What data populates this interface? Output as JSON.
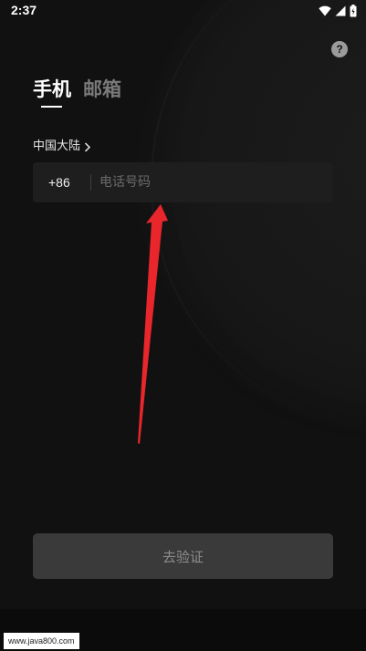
{
  "status_bar": {
    "time": "2:37",
    "icons": [
      "wifi-icon",
      "signal-icon",
      "battery-icon"
    ]
  },
  "help": {
    "label": "?",
    "icon": "question-mark-icon"
  },
  "tabs": [
    {
      "label": "手机",
      "active": true
    },
    {
      "label": "邮箱",
      "active": false
    }
  ],
  "region": {
    "label": "中国大陆",
    "icon": "chevron-right-icon"
  },
  "phone": {
    "country_code": "+86",
    "placeholder": "电话号码",
    "value": ""
  },
  "verify_button": {
    "label": "去验证"
  },
  "annotation": {
    "icon": "red-arrow-icon",
    "color": "#e8262b"
  },
  "watermark": {
    "text": "www.java800.com"
  },
  "colors": {
    "background": "#111111",
    "input_bg": "#1e1e1e",
    "button_bg": "#3a3a3a",
    "inactive_tab": "#7a7a7a"
  }
}
